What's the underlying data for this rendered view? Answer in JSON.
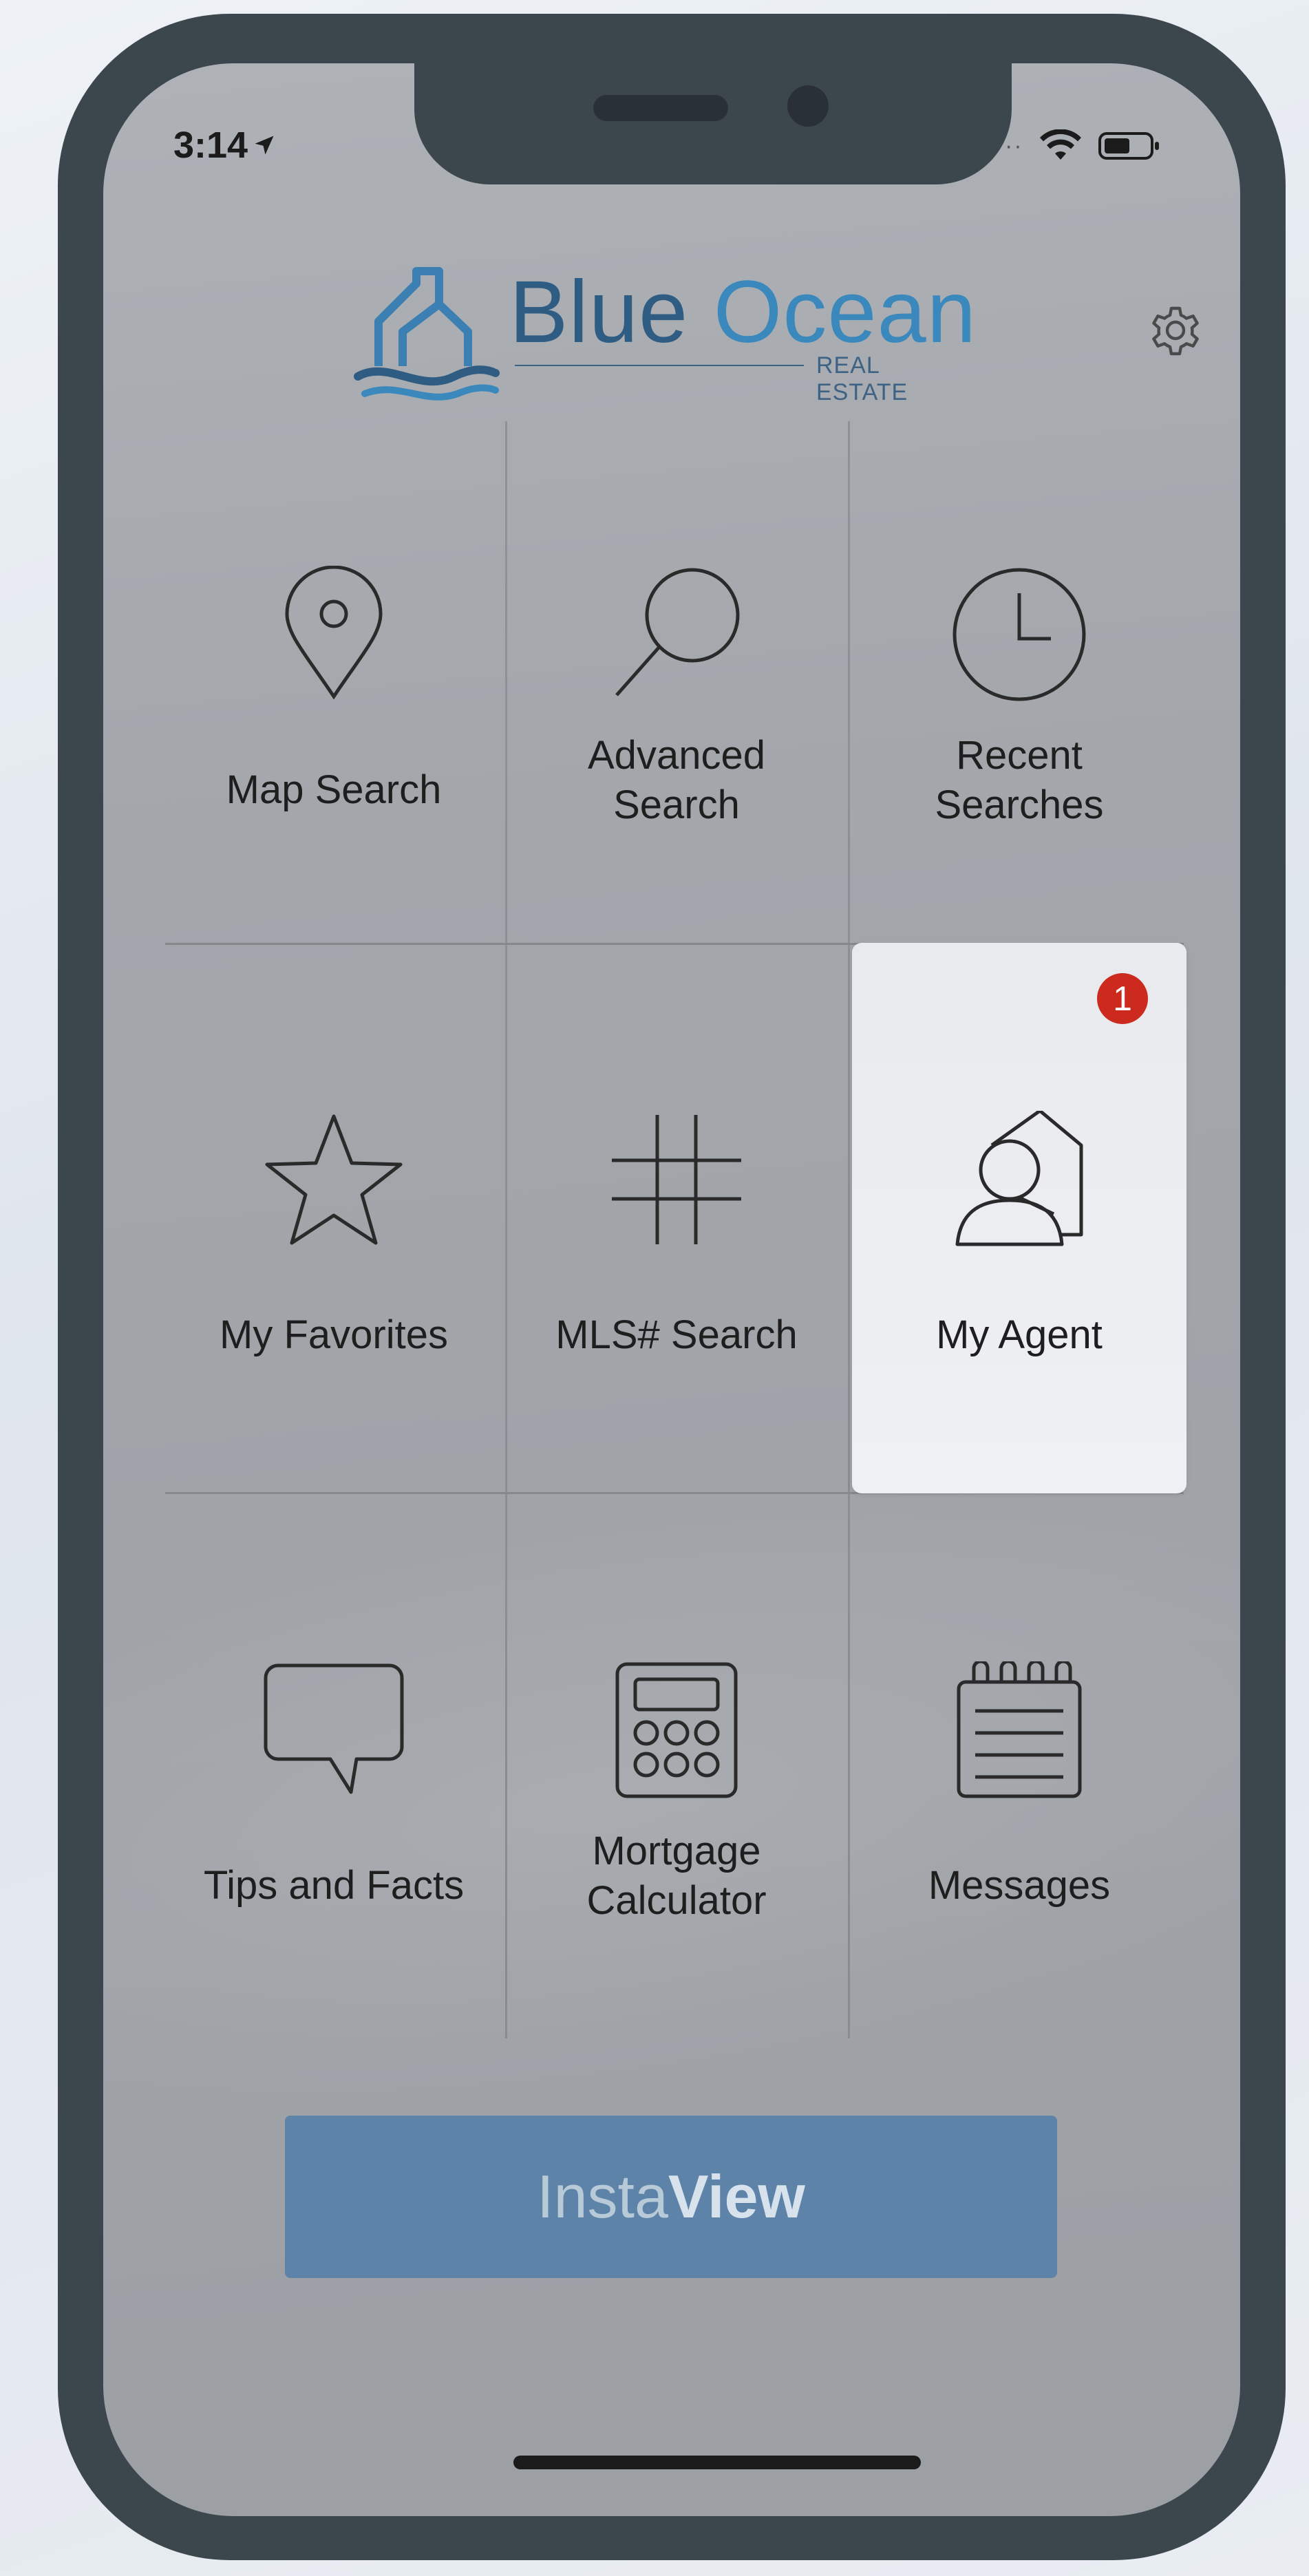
{
  "status_bar": {
    "time": "3:14"
  },
  "brand": {
    "name_part1": "Blue",
    "name_part2": "Ocean",
    "subtitle": "REAL ESTATE"
  },
  "menu": {
    "map_search": "Map Search",
    "advanced_search": {
      "line1": "Advanced",
      "line2": "Search"
    },
    "recent_searches": {
      "line1": "Recent",
      "line2": "Searches"
    },
    "my_favorites": "My Favorites",
    "mls_search": "MLS# Search",
    "my_agent": "My Agent",
    "my_agent_badge": "1",
    "tips_and_facts": "Tips and Facts",
    "mortgage_calculator": {
      "line1": "Mortgage",
      "line2": "Calculator"
    },
    "messages": "Messages"
  },
  "instaview": {
    "part1": "Insta",
    "part2": "View"
  },
  "colors": {
    "brand_dark": "#2f5c83",
    "brand_light": "#3b88bd",
    "instaview_bg": "#5d84a8",
    "badge": "#cc2a1e"
  }
}
